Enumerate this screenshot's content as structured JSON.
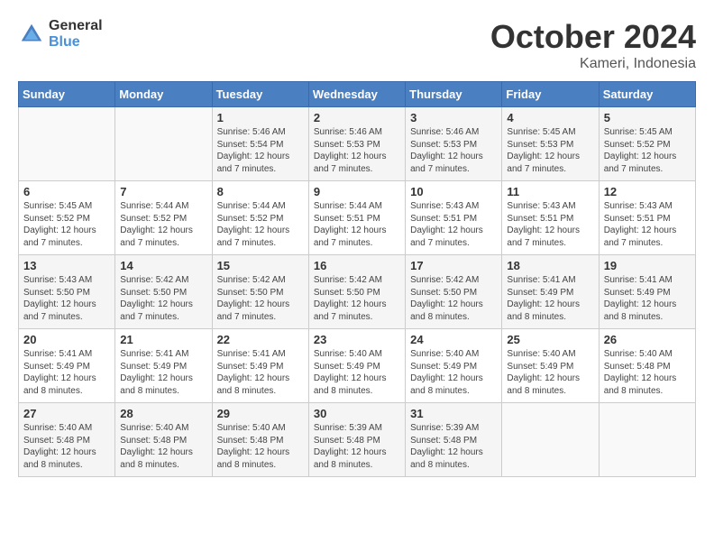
{
  "header": {
    "logo_general": "General",
    "logo_blue": "Blue",
    "month": "October 2024",
    "location": "Kameri, Indonesia"
  },
  "days_of_week": [
    "Sunday",
    "Monday",
    "Tuesday",
    "Wednesday",
    "Thursday",
    "Friday",
    "Saturday"
  ],
  "weeks": [
    [
      {
        "day": "",
        "info": ""
      },
      {
        "day": "",
        "info": ""
      },
      {
        "day": "1",
        "info": "Sunrise: 5:46 AM\nSunset: 5:54 PM\nDaylight: 12 hours\nand 7 minutes."
      },
      {
        "day": "2",
        "info": "Sunrise: 5:46 AM\nSunset: 5:53 PM\nDaylight: 12 hours\nand 7 minutes."
      },
      {
        "day": "3",
        "info": "Sunrise: 5:46 AM\nSunset: 5:53 PM\nDaylight: 12 hours\nand 7 minutes."
      },
      {
        "day": "4",
        "info": "Sunrise: 5:45 AM\nSunset: 5:53 PM\nDaylight: 12 hours\nand 7 minutes."
      },
      {
        "day": "5",
        "info": "Sunrise: 5:45 AM\nSunset: 5:52 PM\nDaylight: 12 hours\nand 7 minutes."
      }
    ],
    [
      {
        "day": "6",
        "info": "Sunrise: 5:45 AM\nSunset: 5:52 PM\nDaylight: 12 hours\nand 7 minutes."
      },
      {
        "day": "7",
        "info": "Sunrise: 5:44 AM\nSunset: 5:52 PM\nDaylight: 12 hours\nand 7 minutes."
      },
      {
        "day": "8",
        "info": "Sunrise: 5:44 AM\nSunset: 5:52 PM\nDaylight: 12 hours\nand 7 minutes."
      },
      {
        "day": "9",
        "info": "Sunrise: 5:44 AM\nSunset: 5:51 PM\nDaylight: 12 hours\nand 7 minutes."
      },
      {
        "day": "10",
        "info": "Sunrise: 5:43 AM\nSunset: 5:51 PM\nDaylight: 12 hours\nand 7 minutes."
      },
      {
        "day": "11",
        "info": "Sunrise: 5:43 AM\nSunset: 5:51 PM\nDaylight: 12 hours\nand 7 minutes."
      },
      {
        "day": "12",
        "info": "Sunrise: 5:43 AM\nSunset: 5:51 PM\nDaylight: 12 hours\nand 7 minutes."
      }
    ],
    [
      {
        "day": "13",
        "info": "Sunrise: 5:43 AM\nSunset: 5:50 PM\nDaylight: 12 hours\nand 7 minutes."
      },
      {
        "day": "14",
        "info": "Sunrise: 5:42 AM\nSunset: 5:50 PM\nDaylight: 12 hours\nand 7 minutes."
      },
      {
        "day": "15",
        "info": "Sunrise: 5:42 AM\nSunset: 5:50 PM\nDaylight: 12 hours\nand 7 minutes."
      },
      {
        "day": "16",
        "info": "Sunrise: 5:42 AM\nSunset: 5:50 PM\nDaylight: 12 hours\nand 7 minutes."
      },
      {
        "day": "17",
        "info": "Sunrise: 5:42 AM\nSunset: 5:50 PM\nDaylight: 12 hours\nand 8 minutes."
      },
      {
        "day": "18",
        "info": "Sunrise: 5:41 AM\nSunset: 5:49 PM\nDaylight: 12 hours\nand 8 minutes."
      },
      {
        "day": "19",
        "info": "Sunrise: 5:41 AM\nSunset: 5:49 PM\nDaylight: 12 hours\nand 8 minutes."
      }
    ],
    [
      {
        "day": "20",
        "info": "Sunrise: 5:41 AM\nSunset: 5:49 PM\nDaylight: 12 hours\nand 8 minutes."
      },
      {
        "day": "21",
        "info": "Sunrise: 5:41 AM\nSunset: 5:49 PM\nDaylight: 12 hours\nand 8 minutes."
      },
      {
        "day": "22",
        "info": "Sunrise: 5:41 AM\nSunset: 5:49 PM\nDaylight: 12 hours\nand 8 minutes."
      },
      {
        "day": "23",
        "info": "Sunrise: 5:40 AM\nSunset: 5:49 PM\nDaylight: 12 hours\nand 8 minutes."
      },
      {
        "day": "24",
        "info": "Sunrise: 5:40 AM\nSunset: 5:49 PM\nDaylight: 12 hours\nand 8 minutes."
      },
      {
        "day": "25",
        "info": "Sunrise: 5:40 AM\nSunset: 5:49 PM\nDaylight: 12 hours\nand 8 minutes."
      },
      {
        "day": "26",
        "info": "Sunrise: 5:40 AM\nSunset: 5:48 PM\nDaylight: 12 hours\nand 8 minutes."
      }
    ],
    [
      {
        "day": "27",
        "info": "Sunrise: 5:40 AM\nSunset: 5:48 PM\nDaylight: 12 hours\nand 8 minutes."
      },
      {
        "day": "28",
        "info": "Sunrise: 5:40 AM\nSunset: 5:48 PM\nDaylight: 12 hours\nand 8 minutes."
      },
      {
        "day": "29",
        "info": "Sunrise: 5:40 AM\nSunset: 5:48 PM\nDaylight: 12 hours\nand 8 minutes."
      },
      {
        "day": "30",
        "info": "Sunrise: 5:39 AM\nSunset: 5:48 PM\nDaylight: 12 hours\nand 8 minutes."
      },
      {
        "day": "31",
        "info": "Sunrise: 5:39 AM\nSunset: 5:48 PM\nDaylight: 12 hours\nand 8 minutes."
      },
      {
        "day": "",
        "info": ""
      },
      {
        "day": "",
        "info": ""
      }
    ]
  ]
}
